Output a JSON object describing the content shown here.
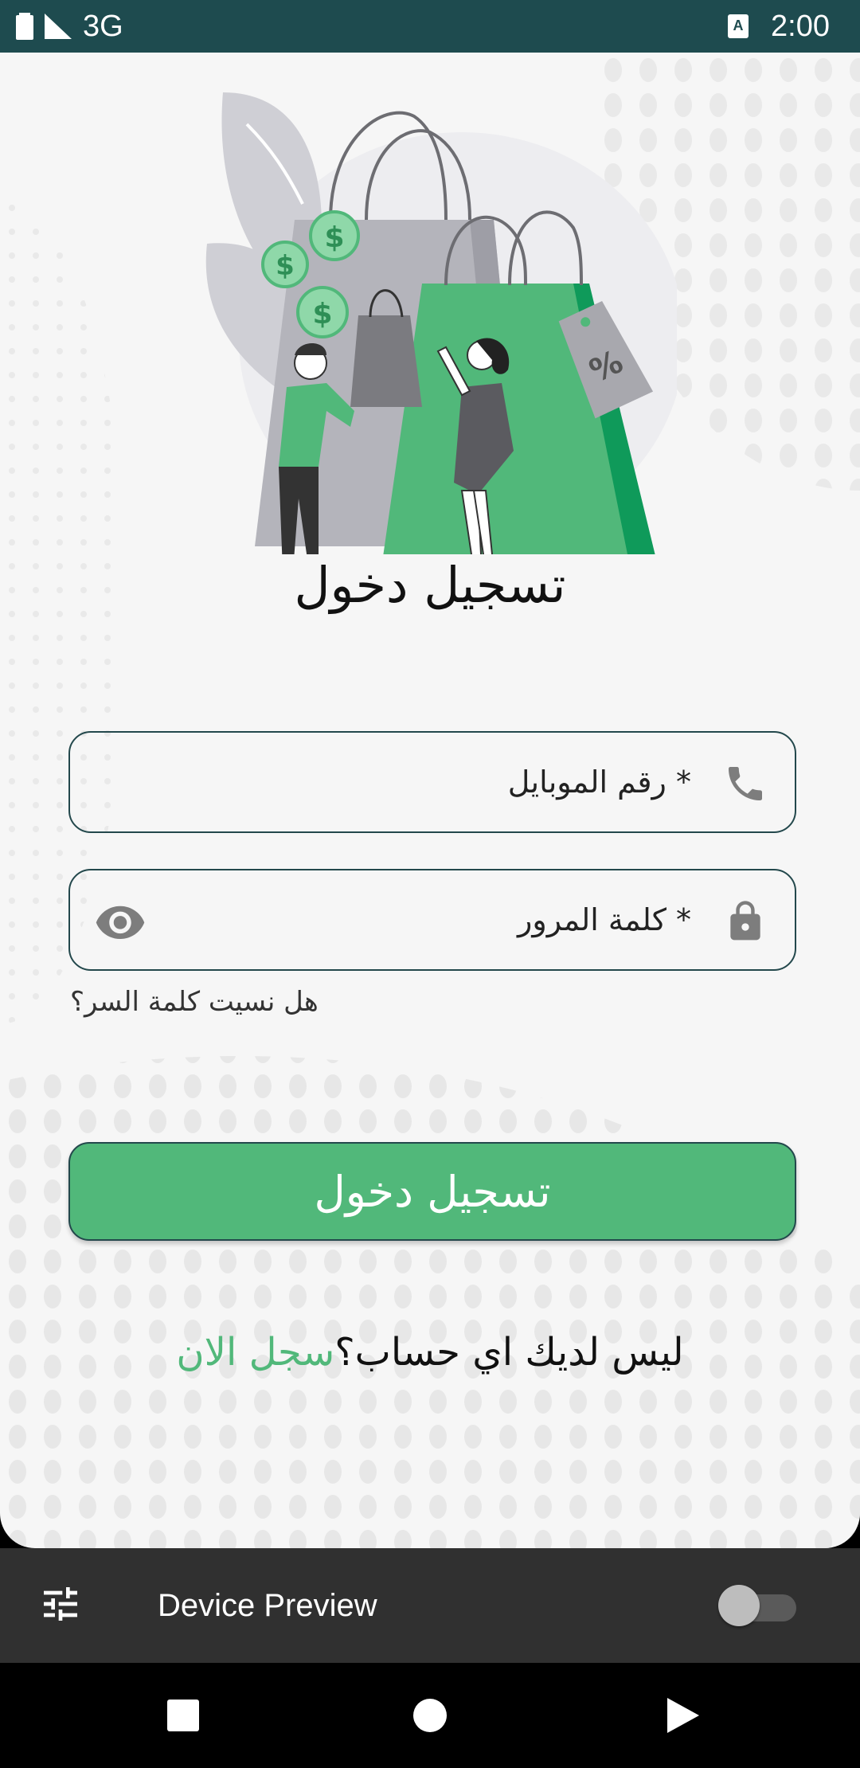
{
  "status_bar": {
    "network": "3G",
    "time": "2:00"
  },
  "login": {
    "title": "تسجيل دخول",
    "phone_label": "* رقم الموبايل",
    "password_label": "* كلمة المرور",
    "forgot_password": "هل نسيت كلمة السر؟",
    "login_button": "تسجيل دخول",
    "no_account_text": "ليس لديك اي حساب؟",
    "signup_link": "سجل الان"
  },
  "device_preview": {
    "title": "Device Preview",
    "enabled": false
  },
  "colors": {
    "status_bar": "#1e4b4f",
    "accent_green": "#51b87a",
    "field_border": "#23484c",
    "background": "#f6f6f6"
  },
  "icons": {
    "phone_field": "phone-icon",
    "password_field": "lock-icon",
    "password_visibility": "eye-icon",
    "settings": "tune-icon"
  }
}
